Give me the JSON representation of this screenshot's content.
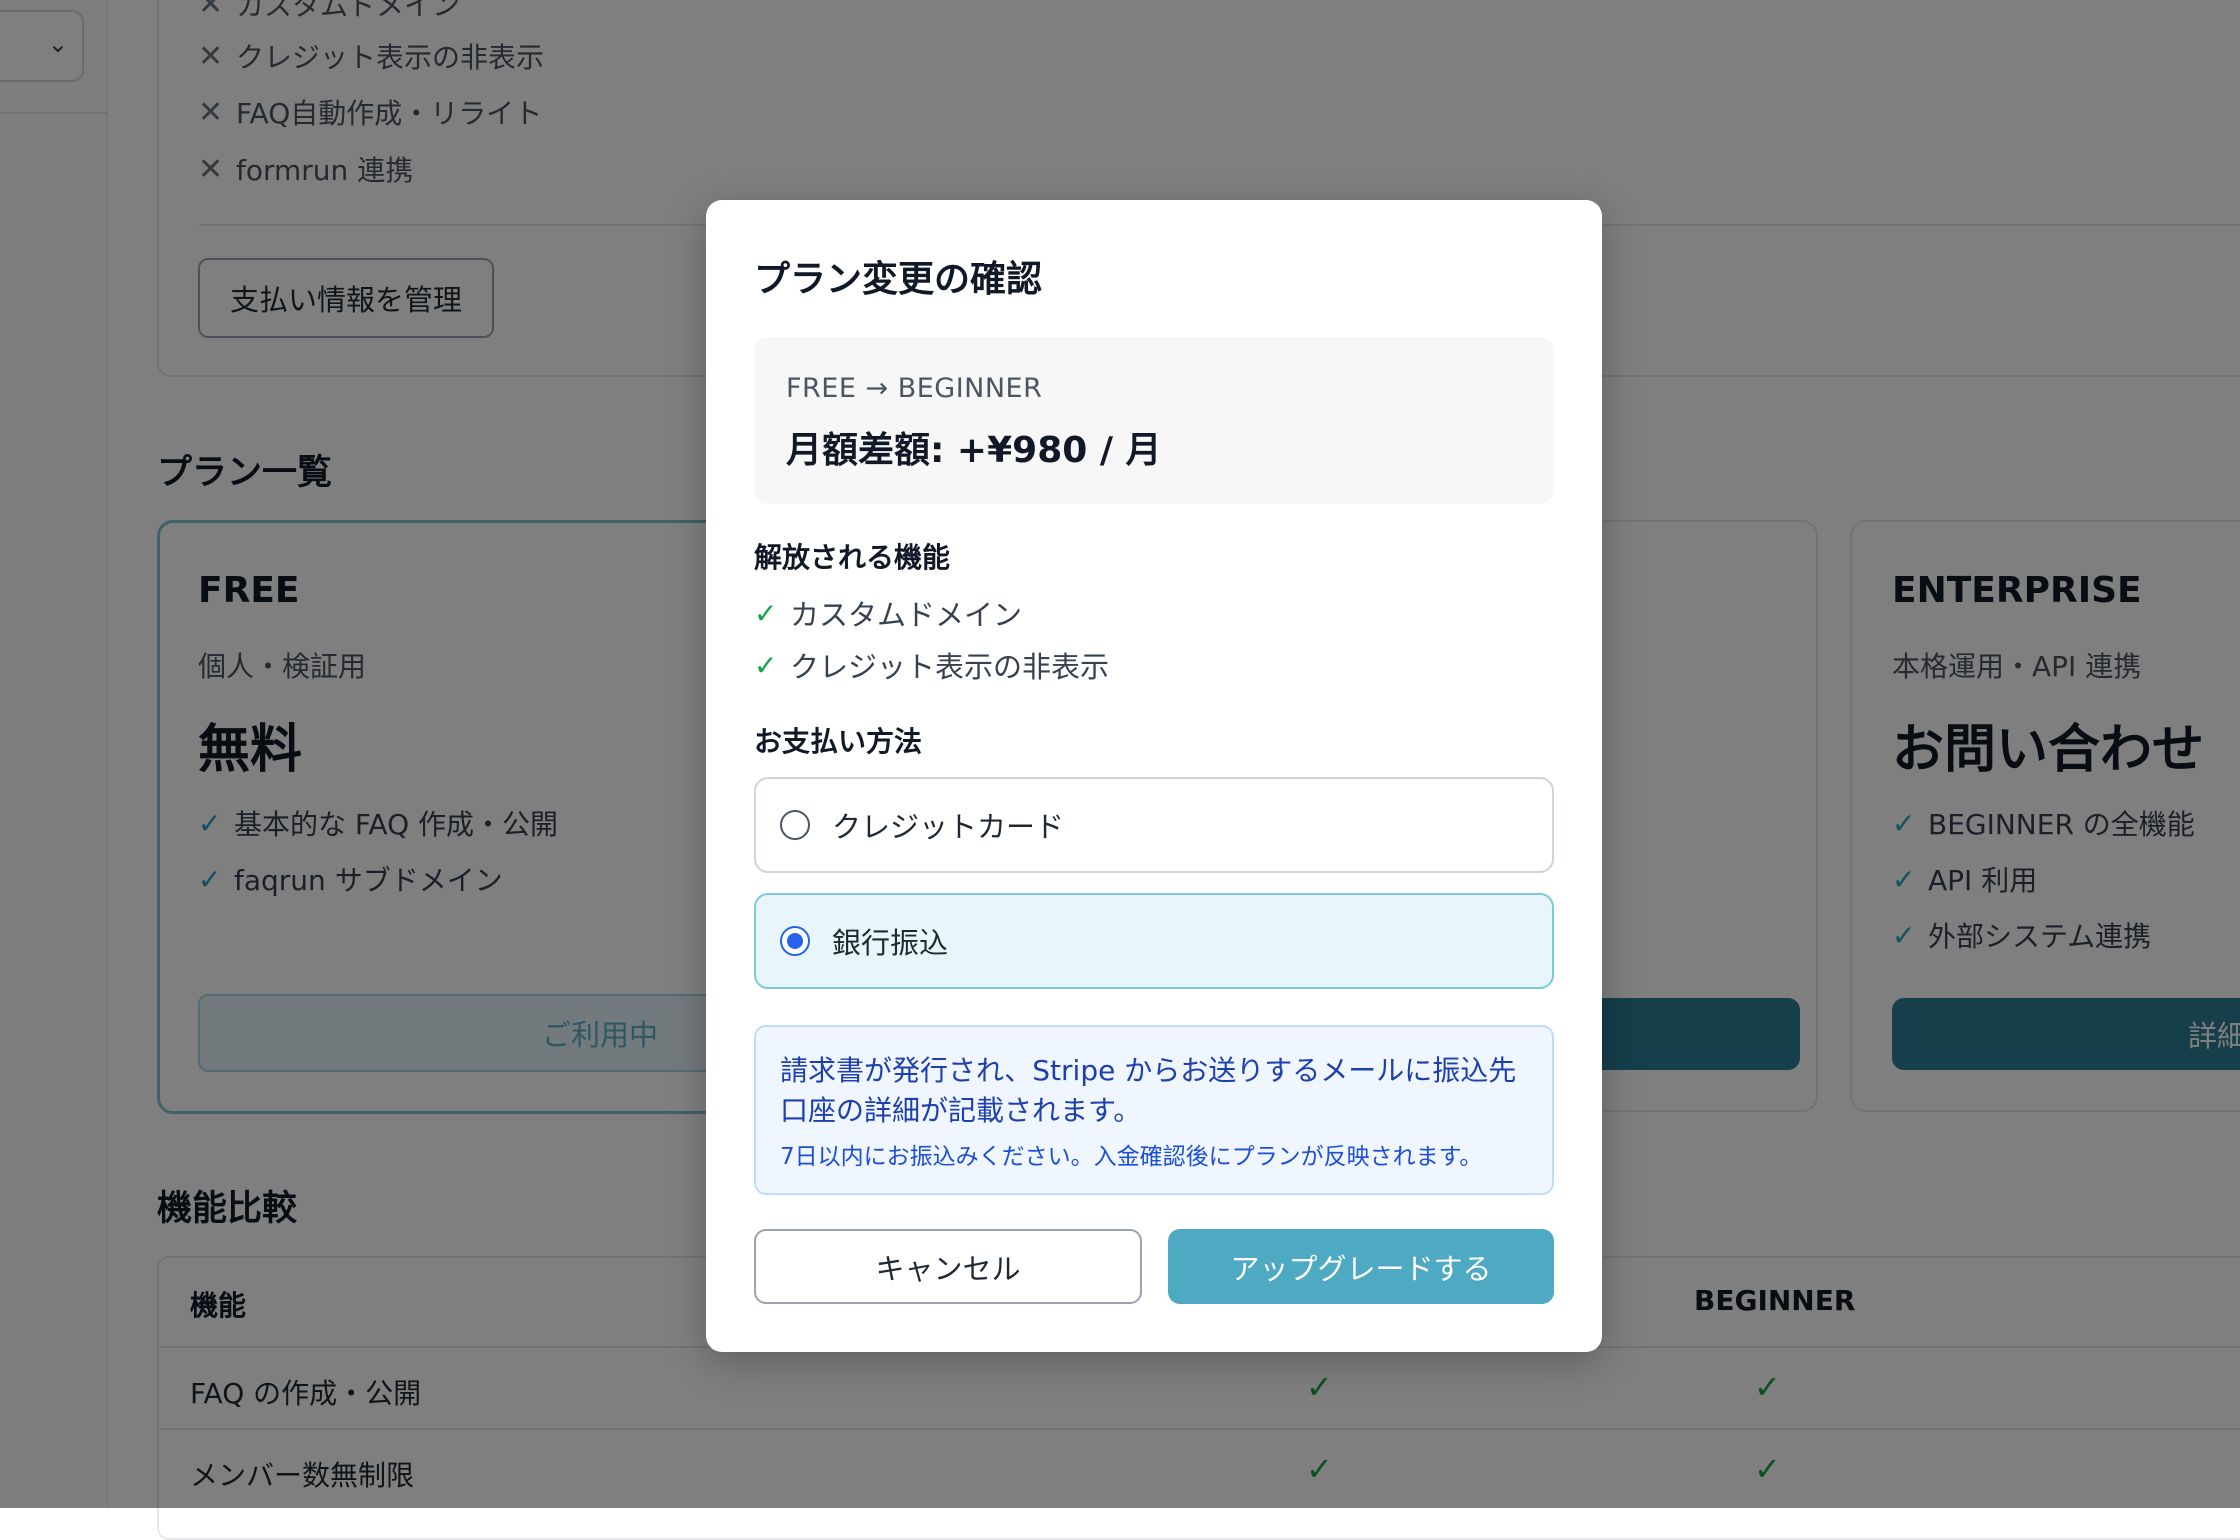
{
  "current_plan": {
    "excluded_features": [
      "カスタムドメイン",
      "クレジット表示の非表示",
      "FAQ自動作成・リライト",
      "formrun 連携"
    ],
    "manage_button_label": "支払い情報を管理"
  },
  "plans_section": {
    "title": "プラン一覧",
    "free": {
      "name": "FREE",
      "desc": "個人・検証用",
      "price": "無料",
      "features": [
        "基本的な FAQ 作成・公開",
        "faqrun サブドメイン"
      ],
      "button_label": "ご利用中"
    },
    "enterprise": {
      "name": "ENTERPRISE",
      "desc": "本格運用・API 連携",
      "price": "お問い合わせ",
      "features": [
        "BEGINNER の全機能",
        "API 利用",
        "外部システム連携"
      ],
      "button_label": "詳細"
    }
  },
  "comparison": {
    "title": "機能比較",
    "header_feature": "機能",
    "header_beginner": "BEGINNER",
    "rows": [
      {
        "label": "FAQ の作成・公開",
        "free": "✓",
        "beginner": "✓"
      },
      {
        "label": "メンバー数無制限",
        "free": "✓",
        "beginner": "✓"
      }
    ]
  },
  "modal": {
    "title": "プラン変更の確認",
    "transition": "FREE → BEGINNER",
    "price_diff": "月額差額: +¥980 / 月",
    "unlocked_label": "解放される機能",
    "unlocked_features": [
      "カスタムドメイン",
      "クレジット表示の非表示"
    ],
    "payment_label": "お支払い方法",
    "payment_options": [
      {
        "label": "クレジットカード",
        "selected": false
      },
      {
        "label": "銀行振込",
        "selected": true
      }
    ],
    "info_main": "請求書が発行され、Stripe からお送りするメールに振込先口座の詳細が記載されます。",
    "info_sub": "7日以内にお振込みください。入金確認後にプランが反映されます。",
    "cancel_label": "キャンセル",
    "upgrade_label": "アップグレードする"
  },
  "colors": {
    "accent": "#4eaac2",
    "accent_dark": "#2d7e96",
    "check_green": "#16a34a",
    "info_blue": "#1e40af",
    "radio_blue": "#2563eb"
  }
}
